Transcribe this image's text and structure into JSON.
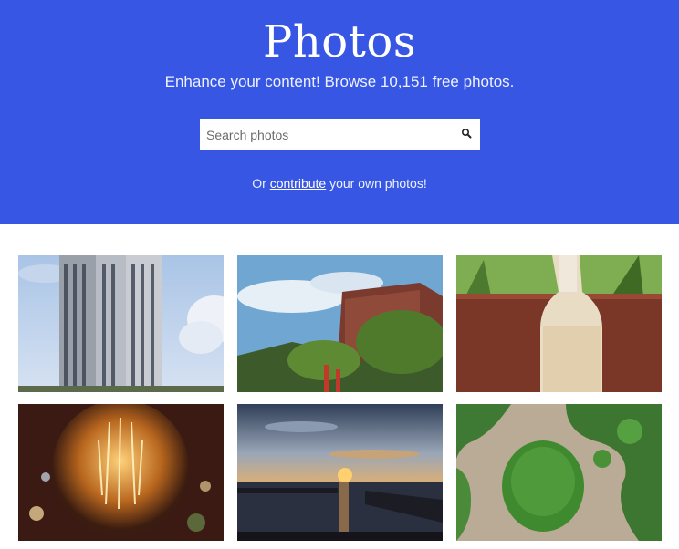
{
  "hero": {
    "title": "Photos",
    "subtitle": "Enhance your content! Browse 10,151 free photos.",
    "background_color": "#3656e3",
    "search": {
      "placeholder": "Search photos",
      "value": "",
      "icon": "search-icon"
    },
    "contribute": {
      "prefix": "Or",
      "link_label": "contribute",
      "suffix": "your own photos!"
    }
  },
  "gallery": {
    "photos": [
      {
        "subject": "skyscraper"
      },
      {
        "subject": "hillside-building"
      },
      {
        "subject": "milk-bottle"
      },
      {
        "subject": "light-bulb"
      },
      {
        "subject": "harbor-sunset"
      },
      {
        "subject": "aerial-mangrove"
      }
    ]
  }
}
